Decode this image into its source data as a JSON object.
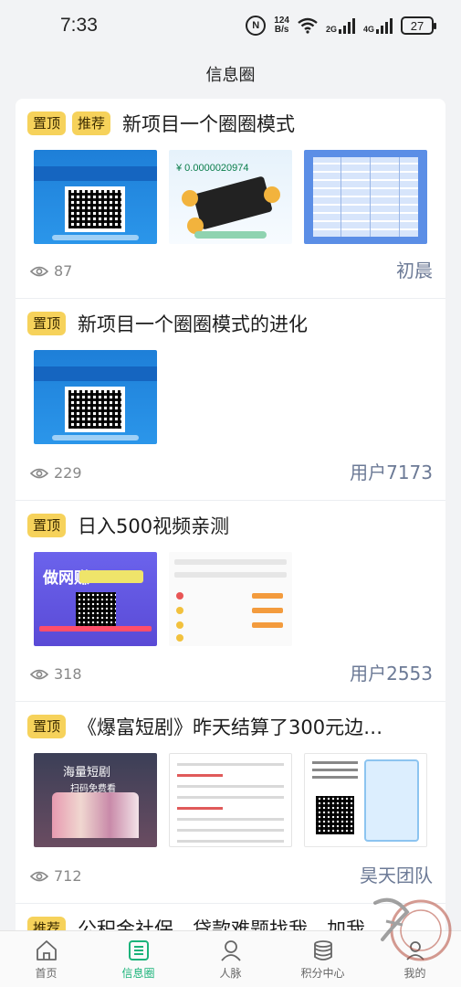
{
  "status_bar": {
    "time": "7:33",
    "speed_top": "124",
    "speed_bottom": "B/s",
    "net1": "2G",
    "net2": "4G",
    "battery": "27",
    "nfc": "N"
  },
  "header": {
    "title": "信息圈"
  },
  "posts": [
    {
      "tags": [
        "置顶",
        "推荐"
      ],
      "title": "新项目一个圈圈模式",
      "views": "87",
      "author": "初晨"
    },
    {
      "tags": [
        "置顶"
      ],
      "title": "新项目一个圈圈模式的进化",
      "views": "229",
      "author": "用户7173"
    },
    {
      "tags": [
        "置顶"
      ],
      "title": "日入500视频亲测",
      "views": "318",
      "author": "用户2553"
    },
    {
      "tags": [
        "置顶"
      ],
      "title": "《爆富短剧》昨天结算了300元边…",
      "views": "712",
      "author": "昊天团队"
    },
    {
      "tags": [
        "推荐"
      ],
      "title": "公积金社保，贷款难题找我，加我"
    }
  ],
  "thumbnail_text": {
    "app_balance": "¥ 0.0000020974",
    "ad_big": "做网赚",
    "drama_title": "海量短剧",
    "drama_sub": "扫码免费看"
  },
  "bottom_nav": [
    {
      "label": "首页",
      "icon": "home-icon",
      "active": false
    },
    {
      "label": "信息圈",
      "icon": "list-icon",
      "active": true
    },
    {
      "label": "人脉",
      "icon": "person-icon",
      "active": false
    },
    {
      "label": "积分中心",
      "icon": "coins-icon",
      "active": false
    },
    {
      "label": "我的",
      "icon": "profile-icon",
      "active": false
    }
  ],
  "colors": {
    "accent": "#1bb37a",
    "tag_bg": "#f6d25b",
    "author": "#6c7a96"
  }
}
